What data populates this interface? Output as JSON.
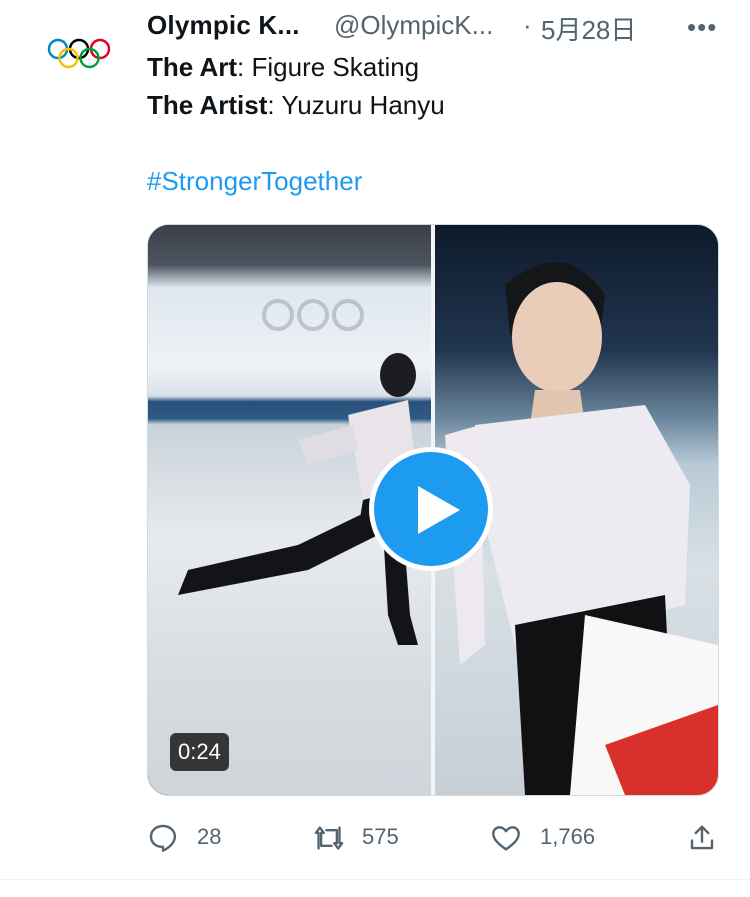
{
  "tweet": {
    "account_name": "Olympic K...",
    "handle": "@OlympicK...",
    "separator": "·",
    "date": "5月28日",
    "more_icon": "more-dots-icon",
    "text_lines": [
      {
        "label": "The Art",
        "value": ": Figure Skating"
      },
      {
        "label": "The Artist",
        "value": ": Yuzuru Hanyu"
      }
    ],
    "hashtag": "#StrongerTogether",
    "media": {
      "duration": "0:24",
      "play_icon": "play-icon"
    },
    "actions": {
      "replies": "28",
      "retweets": "575",
      "likes": "1,766"
    }
  },
  "colors": {
    "link": "#1d9bf0",
    "secondary_text": "#536471",
    "play_button": "#1d9bf0"
  }
}
